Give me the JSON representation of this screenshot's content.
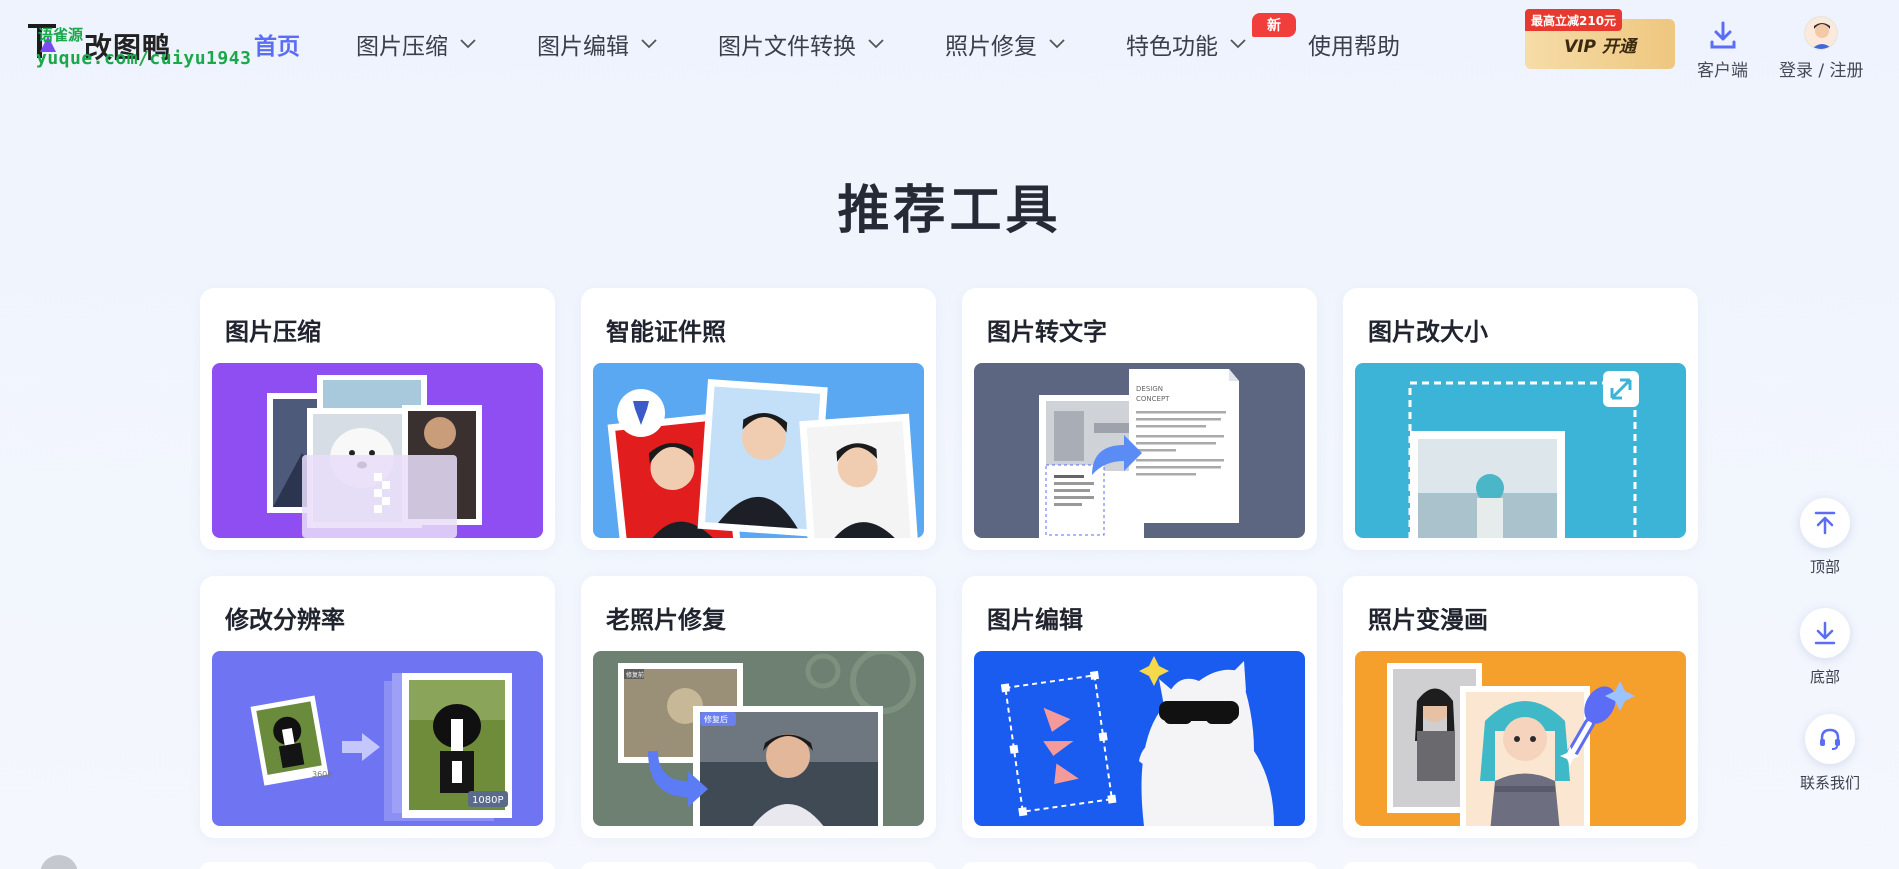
{
  "logo": {
    "text": "改图鸭",
    "watermark_top": "语雀源",
    "watermark_bottom": "yuque.com/cuiyu1943"
  },
  "nav": {
    "items": [
      {
        "label": "首页",
        "active": true,
        "dropdown": false
      },
      {
        "label": "图片压缩",
        "active": false,
        "dropdown": true
      },
      {
        "label": "图片编辑",
        "active": false,
        "dropdown": true
      },
      {
        "label": "图片文件转换",
        "active": false,
        "dropdown": true
      },
      {
        "label": "照片修复",
        "active": false,
        "dropdown": true
      },
      {
        "label": "特色功能",
        "active": false,
        "dropdown": true
      },
      {
        "label": "使用帮助",
        "active": false,
        "dropdown": false
      }
    ],
    "new_badge": "新"
  },
  "header_right": {
    "vip_tag": "最高立减210元",
    "vip_label": "VIP 开通",
    "client_label": "客户端",
    "login_label": "登录 / 注册"
  },
  "section": {
    "title": "推荐工具"
  },
  "tools": [
    {
      "title": "图片压缩",
      "icon": "compress-illustration"
    },
    {
      "title": "智能证件照",
      "icon": "id-photo-illustration"
    },
    {
      "title": "图片转文字",
      "icon": "ocr-illustration"
    },
    {
      "title": "图片改大小",
      "icon": "resize-illustration"
    },
    {
      "title": "修改分辨率",
      "icon": "resolution-illustration",
      "badge_small": "360P",
      "badge_large": "1080P"
    },
    {
      "title": "老照片修复",
      "icon": "old-photo-illustration",
      "badge_before": "修复前",
      "badge_after": "修复后"
    },
    {
      "title": "图片编辑",
      "icon": "edit-illustration"
    },
    {
      "title": "照片变漫画",
      "icon": "cartoon-illustration"
    }
  ],
  "ocr_doc_lines": [
    "DESIGN",
    "CONCEPT"
  ],
  "float_buttons": {
    "top_label": "顶部",
    "bottom_label": "底部",
    "contact_label": "联系我们"
  },
  "colors": {
    "accent": "#5b6cf5",
    "new_badge": "#f23d3d",
    "vip_gold": "#eec77f"
  }
}
